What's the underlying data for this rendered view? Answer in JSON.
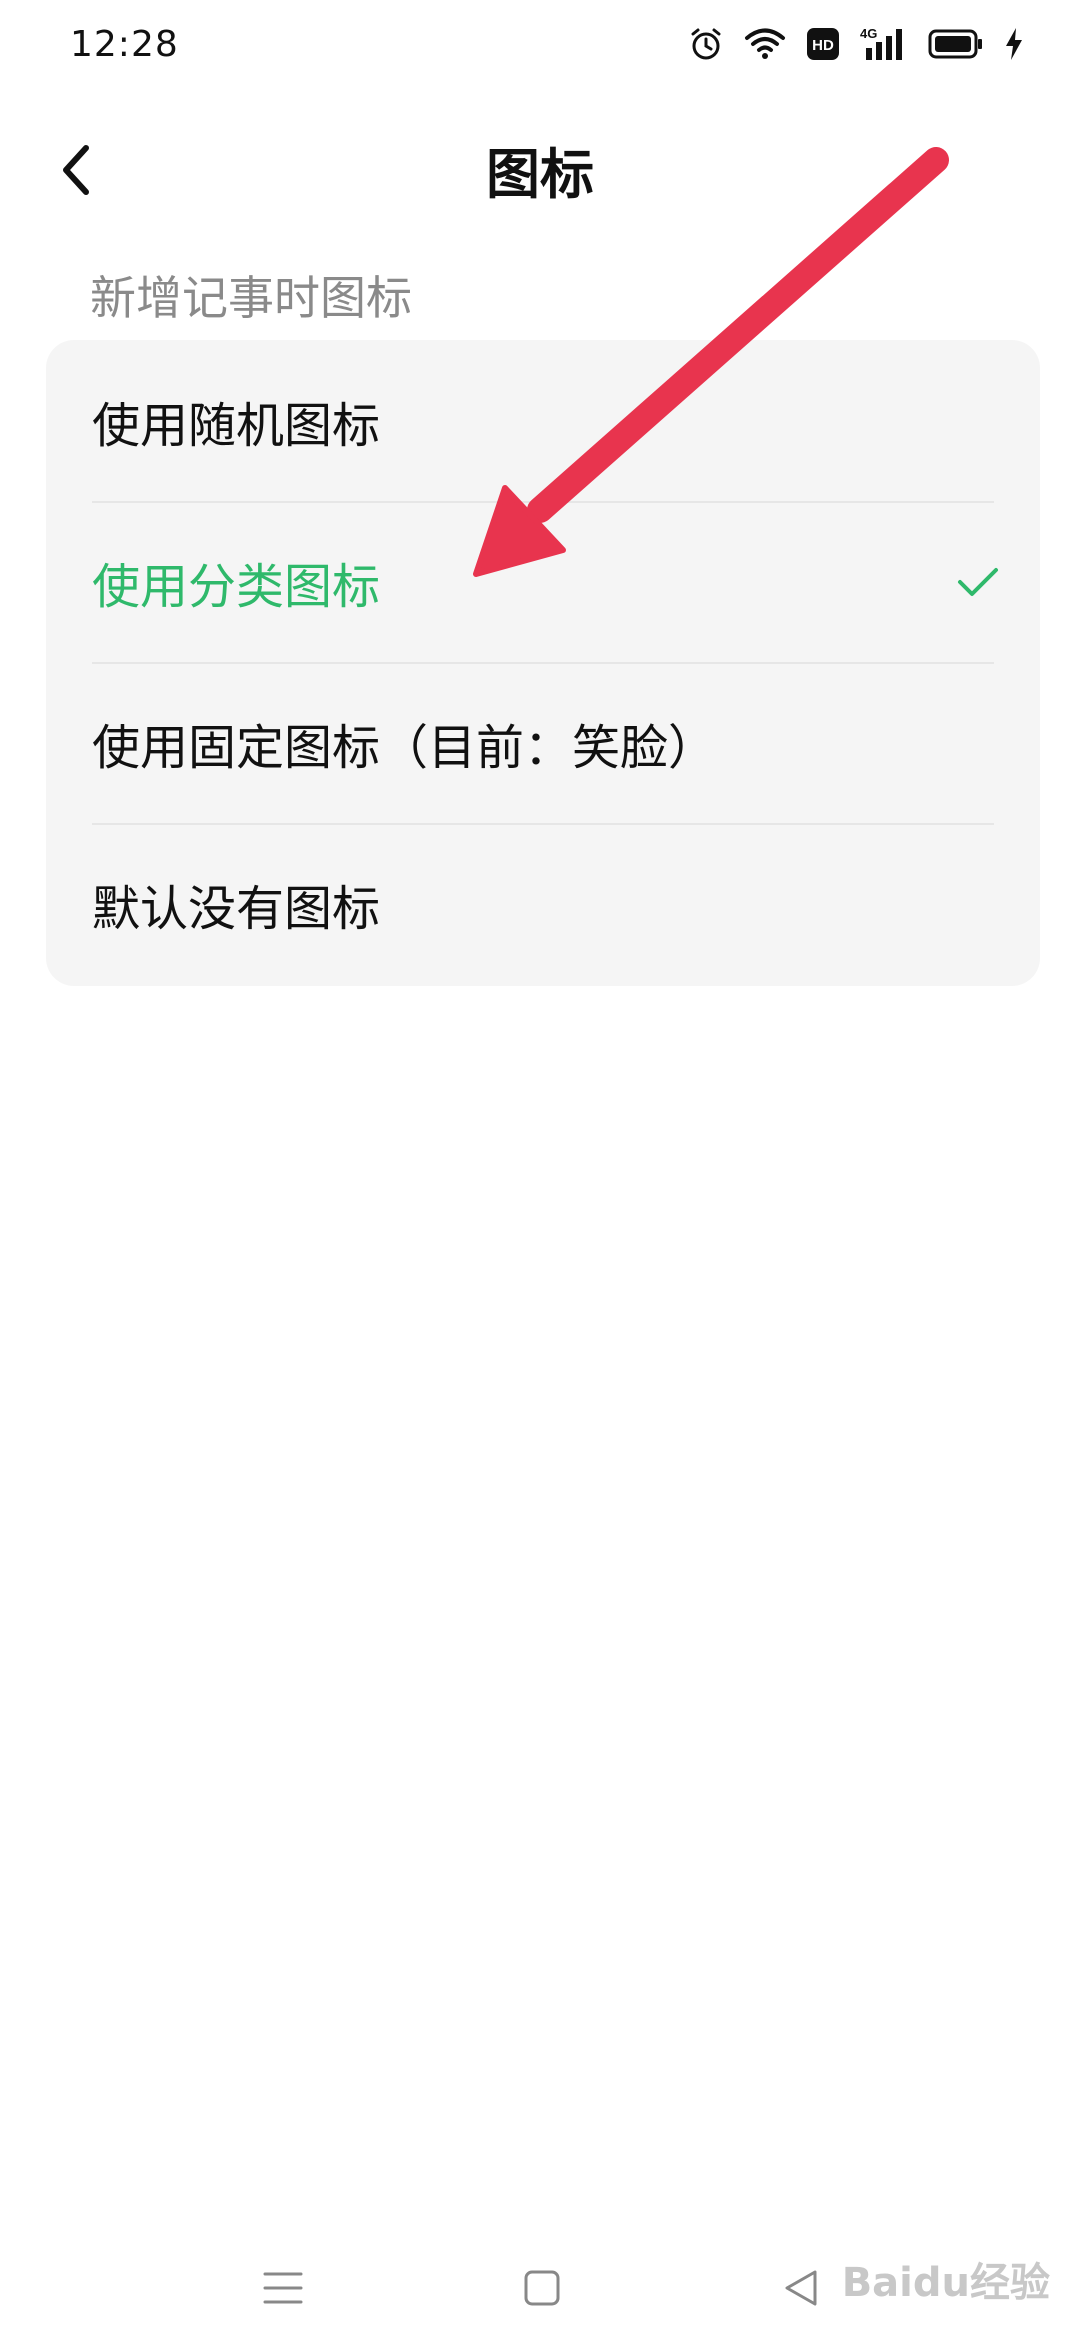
{
  "status_bar": {
    "time": "12:28",
    "icons": [
      "alarm-icon",
      "wifi-icon",
      "hd-icon",
      "4g-signal-icon",
      "battery-icon",
      "charging-icon"
    ],
    "hd_label": "HD",
    "network_label": "4G"
  },
  "header": {
    "title": "图标",
    "back_icon": "chevron-left-icon"
  },
  "section": {
    "label": "新增记事时图标"
  },
  "options": [
    {
      "label": "使用随机图标",
      "selected": false
    },
    {
      "label": "使用分类图标",
      "selected": true
    },
    {
      "label": "使用固定图标（目前：笑脸）",
      "selected": false
    },
    {
      "label": "默认没有图标",
      "selected": false
    }
  ],
  "colors": {
    "accent": "#2fb96b",
    "annotation_arrow": "#e8344e",
    "card_bg": "#f5f5f5",
    "section_text": "#8a8a8a"
  },
  "nav_bar": {
    "icons": [
      "menu-icon",
      "home-square-icon",
      "back-triangle-icon"
    ]
  },
  "watermark": {
    "text": "Baidu经验"
  }
}
